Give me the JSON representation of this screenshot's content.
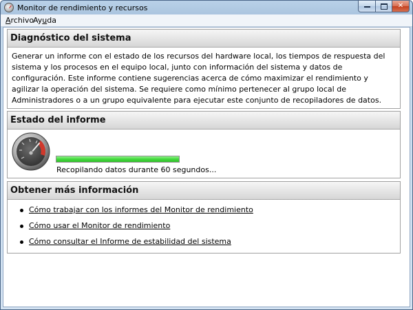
{
  "window": {
    "title": "Monitor de rendimiento y recursos"
  },
  "menu": {
    "archivo_pre": "",
    "archivo_ul": "A",
    "archivo_post": "rchivo",
    "ayuda_pre": "Ay",
    "ayuda_ul": "u",
    "ayuda_post": "da"
  },
  "diagnostico": {
    "title": "Diagnóstico del sistema",
    "description": "Generar un informe con el estado de los recursos del hardware local, los tiempos de respuesta del sistema y los procesos en el equipo local, junto con información del sistema y datos de configuración. Este informe contiene sugerencias acerca de cómo maximizar el rendimiento y agilizar la operación del sistema. Se requiere como mínimo pertenecer al grupo local de Administradores o a un grupo equivalente para ejecutar este conjunto de recopiladores de datos."
  },
  "estado": {
    "title": "Estado del informe",
    "progress_percent": 100,
    "status_text": "Recopilando datos durante 60 segundos..."
  },
  "mas_info": {
    "title": "Obtener más información",
    "links": [
      "Cómo trabajar con los informes del Monitor de rendimiento",
      "Cómo usar el Monitor de rendimiento",
      "Cómo consultar el Informe de estabilidad del sistema"
    ]
  },
  "colors": {
    "progress_green": "#44d93d",
    "gauge_red": "#d0382b"
  },
  "icons": {
    "app": "performance-gauge-icon",
    "status": "performance-gauge-icon"
  }
}
